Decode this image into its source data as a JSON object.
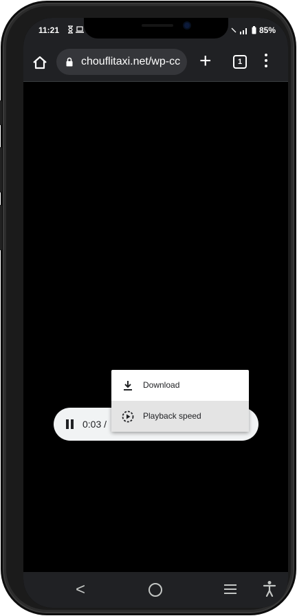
{
  "status_bar": {
    "time": "11:21",
    "battery": "85%"
  },
  "browser": {
    "url": "chouflitaxi.net/wp-cc",
    "tab_count": "1",
    "new_tab_glyph": "+"
  },
  "player": {
    "time": "0:03 /"
  },
  "context_menu": {
    "items": [
      {
        "label": "Download",
        "icon": "download-icon"
      },
      {
        "label": "Playback speed",
        "icon": "playback-speed-icon"
      }
    ]
  },
  "nav_bar": {
    "back_glyph": "<"
  },
  "colors": {
    "browser_chrome": "#202124",
    "url_pill": "#35363a",
    "menu_hover": "#e4e4e4",
    "player_bg": "#f1f3f4"
  }
}
